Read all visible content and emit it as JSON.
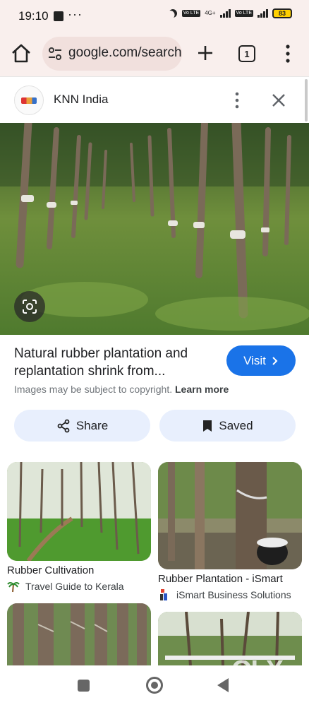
{
  "status_bar": {
    "time": "19:10",
    "dots": "···",
    "sim1": "Vo LTE",
    "net": "4G+",
    "sim2": "Vo LTE",
    "battery": "83"
  },
  "browser": {
    "url": "google.com/search",
    "tab_count": "1"
  },
  "source": {
    "name": "KNN India"
  },
  "result": {
    "title": "Natural rubber plantation and replantation shrink from...",
    "visit_label": "Visit",
    "copyright_text": "Images may be subject to copyright.",
    "learn_more": "Learn more",
    "share_label": "Share",
    "saved_label": "Saved"
  },
  "related": [
    {
      "title": "Rubber Cultivation",
      "source": "Travel Guide to Kerala",
      "icon": "palm-tree-icon"
    },
    {
      "title": "Rubber Plantation - iSmart",
      "source": "iSmart Business Solutions",
      "icon": "ismart-logo-icon"
    }
  ],
  "watermark": "OLX",
  "colors": {
    "chrome_bg": "#f9efed",
    "url_bg": "#f1e0dd",
    "visit_blue": "#1a73e8",
    "pill_bg": "#e8effd"
  }
}
